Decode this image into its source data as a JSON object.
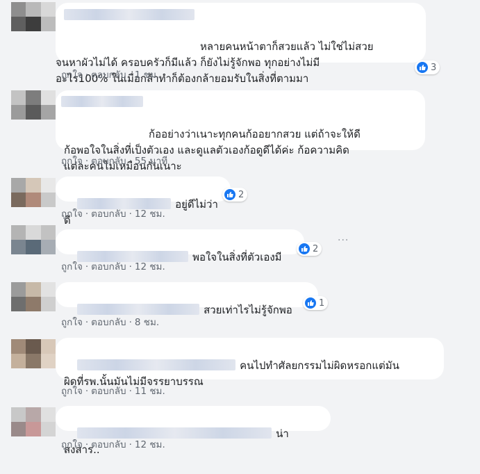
{
  "comments": [
    {
      "text": "หลายคนหน้าตาก็สวยแล้ว ไม่ใช่ไม่สวย\nจนหาผัวไม่ได้ ครอบครัวก็มีแล้ว ก็ยังไม่รู้จักพอ ทุกอย่างไม่มี\nอะไร100% ในเมื่อกล้าทำก็ต้องกล้ายอมรับในสิ่งที่ตามมา",
      "reactions": "3",
      "like": "ถูกใจ",
      "reply": "ตอบกลับ",
      "sep": "·",
      "time": "1 ชม."
    },
    {
      "text": "ก้ออย่างว่าเนาะทุกคนก้ออยากสวย แต่ถ้าจะให้ดี\nก้อพอใจในสิ่งที่เป็งตัวเอง และดูแลตัวเองก้อดูดีได้ค่ะ ก้อความคิด\nแต่ละคนไม่เหมือนกันเนาะ",
      "reactions": "",
      "like": "ถูกใจ",
      "reply": "ตอบกลับ",
      "sep": "·",
      "time": "55 นาที"
    },
    {
      "text": "อยู่ดีไม่ว่าดี",
      "reactions": "2",
      "like": "ถูกใจ",
      "reply": "ตอบกลับ",
      "sep": "·",
      "time": "12 ชม."
    },
    {
      "text": "พอใจในสิ่งที่ตัวเองมี",
      "reactions": "2",
      "like": "ถูกใจ",
      "reply": "ตอบกลับ",
      "sep": "·",
      "time": "12 ชม."
    },
    {
      "text": "สวยเท่าไรไม่รู้จักพอ",
      "reactions": "1",
      "like": "ถูกใจ",
      "reply": "ตอบกลับ",
      "sep": "·",
      "time": "8 ชม."
    },
    {
      "text": "คนไปทำศัลยกรรมไม่ผิดหรอกแต่มัน\nผิดที่รพ.นั้นมันไม่มีจรรยาบรรณ",
      "reactions": "",
      "like": "ถูกใจ",
      "reply": "ตอบกลับ",
      "sep": "·",
      "time": "11 ชม."
    },
    {
      "text": "น่าสงสาร..",
      "reactions": "",
      "like": "ถูกใจ",
      "reply": "ตอบกลับ",
      "sep": "·",
      "time": "12 ชม."
    }
  ],
  "more_options": "···",
  "colors": {
    "like_blue": "#1877f2",
    "bubble": "#ffffff",
    "meta_text": "#606770"
  },
  "icons": {
    "reaction": "thumbs-up-icon"
  }
}
